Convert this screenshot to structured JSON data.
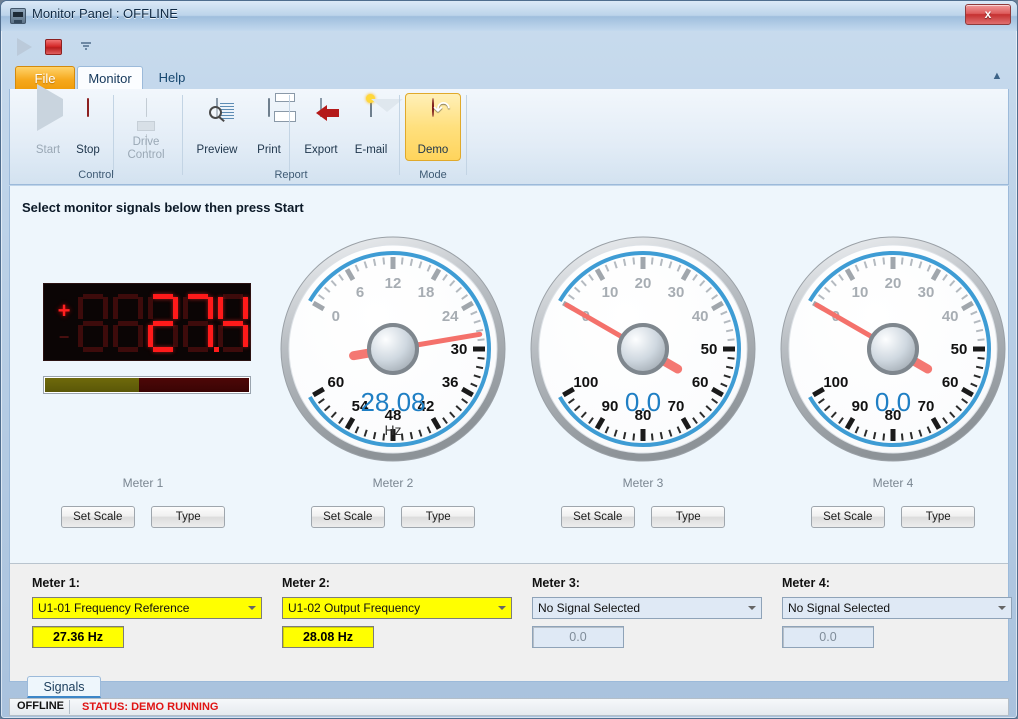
{
  "window": {
    "title": "Monitor Panel : OFFLINE",
    "ghost_text": "",
    "close_label": "x",
    "app_icon": "monitor-panel-icon"
  },
  "quick_access": {
    "start_icon": "play-icon",
    "stop_icon": "stop-icon",
    "overflow_icon": "chevron-down-icon"
  },
  "ribbon": {
    "tabs": [
      {
        "label": "File",
        "id": "file",
        "selected": false
      },
      {
        "label": "Monitor",
        "id": "monitor",
        "selected": true
      },
      {
        "label": "Help",
        "id": "help",
        "selected": false
      }
    ],
    "collapse_icon": "chevron-up-icon",
    "groups": [
      {
        "title": "Control",
        "buttons": [
          {
            "label": "Start",
            "icon": "play-icon",
            "enabled": false
          },
          {
            "label": "Stop",
            "icon": "stop-icon",
            "enabled": true
          },
          {
            "label": "Drive Control",
            "label_line1": "Drive",
            "label_line2": "Control",
            "icon": "drive-icon",
            "enabled": false
          }
        ]
      },
      {
        "title": "Report",
        "buttons": [
          {
            "label": "Preview",
            "icon": "document-magnifier-icon",
            "enabled": true
          },
          {
            "label": "Print",
            "icon": "printer-icon",
            "enabled": true
          },
          {
            "label": "Export",
            "icon": "export-arrow-icon",
            "enabled": true
          },
          {
            "label": "E-mail",
            "icon": "envelope-icon",
            "enabled": true
          }
        ]
      },
      {
        "title": "Mode",
        "buttons": [
          {
            "label": "Demo",
            "icon": "demo-loop-icon",
            "enabled": true,
            "active": true
          }
        ]
      }
    ]
  },
  "main": {
    "hint": "Select monitor signals below then press Start",
    "set_scale_label": "Set Scale",
    "type_label": "Type"
  },
  "meters": [
    {
      "caption": "Meter 1",
      "display_type": "led",
      "led": {
        "plus_active": true,
        "minus_active": false,
        "digits": [
          "8",
          "8",
          "2",
          "7",
          "4"
        ],
        "lit": [
          false,
          false,
          true,
          true,
          true
        ],
        "decimal_index": 3,
        "text": "27.4"
      },
      "bargraph": {
        "percent": 46,
        "fill_color": "#6f6a0b",
        "rest_color": "#4d0707"
      }
    },
    {
      "caption": "Meter 2",
      "display_type": "gauge",
      "gauge": {
        "min": 0,
        "max": 60,
        "step": 6,
        "ticks": [
          "0",
          "6",
          "12",
          "18",
          "24",
          "30",
          "36",
          "42",
          "48",
          "54",
          "60"
        ],
        "value": 28.08,
        "value_text": "28.08",
        "unit": "Hz",
        "needle_angle_deg": 151.2,
        "value_color": "#1f7fc4",
        "arc_color": "#3e9cd4"
      }
    },
    {
      "caption": "Meter 3",
      "display_type": "gauge",
      "gauge": {
        "min": 0,
        "max": 100,
        "step": 10,
        "ticks": [
          "0",
          "10",
          "20",
          "30",
          "40",
          "50",
          "60",
          "70",
          "80",
          "90",
          "100"
        ],
        "value": 0,
        "value_text": "0.0",
        "unit": "",
        "needle_angle_deg": 0,
        "value_color": "#1f7fc4",
        "arc_color": "#3e9cd4"
      }
    },
    {
      "caption": "Meter 4",
      "display_type": "gauge",
      "gauge": {
        "min": 0,
        "max": 100,
        "step": 10,
        "ticks": [
          "0",
          "10",
          "20",
          "30",
          "40",
          "50",
          "60",
          "70",
          "80",
          "90",
          "100"
        ],
        "value": 0,
        "value_text": "0.0",
        "unit": "",
        "needle_angle_deg": 0,
        "value_color": "#1f7fc4",
        "arc_color": "#3e9cd4"
      }
    }
  ],
  "signals": [
    {
      "title": "Meter 1:",
      "selected": "U1-01 Frequency Reference",
      "value": "27.36 Hz",
      "style": "yellow"
    },
    {
      "title": "Meter 2:",
      "selected": "U1-02 Output Frequency",
      "value": "28.08 Hz",
      "style": "yellow"
    },
    {
      "title": "Meter 3:",
      "selected": "No Signal Selected",
      "value": "0.0",
      "style": "blue"
    },
    {
      "title": "Meter 4:",
      "selected": "No Signal Selected",
      "value": "0.0",
      "style": "blue"
    }
  ],
  "bottom_tab": {
    "label": "Signals"
  },
  "statusbar": {
    "connection": "OFFLINE",
    "status": "STATUS: DEMO RUNNING",
    "status_color": "#e01414"
  }
}
